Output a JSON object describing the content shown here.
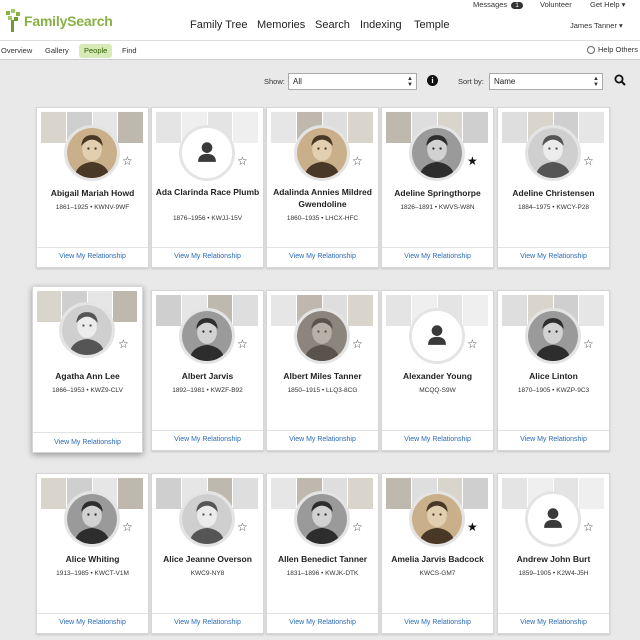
{
  "header": {
    "logo_text": "FamilySearch",
    "messages_label": "Messages",
    "messages_count": "1",
    "volunteer_label": "Volunteer",
    "get_help_label": "Get Help ▾",
    "nav": [
      "Family Tree",
      "Memories",
      "Search",
      "Indexing",
      "Temple"
    ],
    "user_name": "James Tanner ▾"
  },
  "subnav": {
    "tabs": [
      "Overview",
      "Gallery",
      "People",
      "Find"
    ],
    "active_tab": "People",
    "help_others": "Help Others"
  },
  "controls": {
    "show_label": "Show:",
    "show_value": "All",
    "sort_label": "Sort by:",
    "sort_value": "Name"
  },
  "people": [
    {
      "name": "Abigail Mariah Howd",
      "meta": "1861–1925 • KWNV-9WF",
      "link": "View My Relationship",
      "starred": false,
      "photo": "sepia"
    },
    {
      "name": "Ada Clarinda Race Plumb",
      "meta": "1876–1956 • KWJJ-15V",
      "link": "View My Relationship",
      "starred": false,
      "photo": "none"
    },
    {
      "name": "Adalinda Annies Mildred Gwendoline",
      "meta": "1860–1935 • LHCX-HFC",
      "link": "View My Relationship",
      "starred": false,
      "photo": "sepia"
    },
    {
      "name": "Adeline Springthorpe",
      "meta": "1826–1891 • KWVS-W8N",
      "link": "View My Relationship",
      "starred": true,
      "photo": "gray"
    },
    {
      "name": "Adeline Christensen",
      "meta": "1884–1975 • KWCY-P28",
      "link": "View My Relationship",
      "starred": false,
      "photo": "light"
    },
    {
      "name": "Agatha Ann Lee",
      "meta": "1866–1953 • KWZ9-CLV",
      "link": "View My Relationship",
      "starred": false,
      "photo": "light"
    },
    {
      "name": "Albert Jarvis",
      "meta": "1892–1981 • KWZF-B92",
      "link": "View My Relationship",
      "starred": false,
      "photo": "gray"
    },
    {
      "name": "Albert Miles Tanner",
      "meta": "1850–1915 • LLQ3-8CG",
      "link": "View My Relationship",
      "starred": false,
      "photo": "stone"
    },
    {
      "name": "Alexander Young",
      "meta": "MCQQ-S9W",
      "link": "View My Relationship",
      "starred": false,
      "photo": "none"
    },
    {
      "name": "Alice Linton",
      "meta": "1870–1905 • KWZP-9C3",
      "link": "View My Relationship",
      "starred": false,
      "photo": "gray"
    },
    {
      "name": "Alice Whiting",
      "meta": "1913–1985 • KWCT-V1M",
      "link": "View My Relationship",
      "starred": false,
      "photo": "gray"
    },
    {
      "name": "Alice Jeanne Overson",
      "meta": "KWC9-NY8",
      "link": "View My Relationship",
      "starred": false,
      "photo": "light"
    },
    {
      "name": "Allen Benedict Tanner",
      "meta": "1831–1896 • KWJK-DTK",
      "link": "View My Relationship",
      "starred": false,
      "photo": "gray"
    },
    {
      "name": "Amelia Jarvis Badcock",
      "meta": "KWCS-GM7",
      "link": "View My Relationship",
      "starred": true,
      "photo": "sepia"
    },
    {
      "name": "Andrew John Burt",
      "meta": "1859–1905 • K2W4-J5H",
      "link": "View My Relationship",
      "starred": false,
      "photo": "none"
    }
  ],
  "colors": {
    "brand_green": "#87b144",
    "link_blue": "#2a6bb5",
    "active_tab_bg": "#d8ebb6"
  },
  "icons": {
    "info": "i",
    "star_empty": "☆",
    "star_filled": "★"
  }
}
